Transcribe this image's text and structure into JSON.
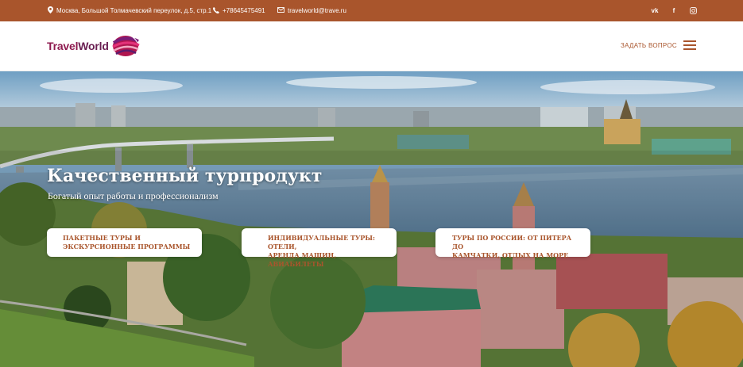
{
  "topbar": {
    "address": "Москва, Большой Толмачевский переулок, д.5, стр.1",
    "phone": "+78645475491",
    "email": "travelworld@trave.ru",
    "socials": [
      {
        "name": "vk-icon",
        "glyph": "vk"
      },
      {
        "name": "facebook-icon",
        "glyph": "f"
      },
      {
        "name": "instagram-icon",
        "glyph": ""
      }
    ]
  },
  "header": {
    "logo_part1": "Travel",
    "logo_part2": "World",
    "ask_label": "ЗАДАТЬ ВОПРОС"
  },
  "hero": {
    "title": "Качественный турпродукт",
    "subtitle": "Богатый опыт работы и профессионализм",
    "cards": [
      {
        "line1": "ПАКЕТНЫЕ ТУРЫ И",
        "line2": "ЭКСКУРСИОННЫЕ ПРОГРАММЫ"
      },
      {
        "line1": "ИНДИВИДУАЛЬНЫЕ ТУРЫ: ОТЕЛИ,",
        "line2": "АРЕНДА МАШИН, АВИАБИЛЕТЫ"
      },
      {
        "line1": "ТУРЫ ПО РОССИИ: ОТ ПИТЕРА ДО",
        "line2": "КАМЧАТКИ, ОТДЫХ НА МОРЕ"
      }
    ]
  },
  "colors": {
    "accent": "#a9552c",
    "logo_magenta": "#8e1a4f",
    "water": "#5b7f9c",
    "foliage": "#4f7a2e"
  }
}
